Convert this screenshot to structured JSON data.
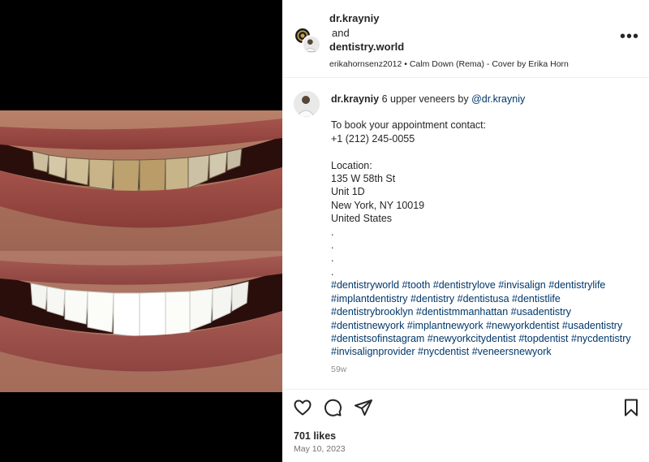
{
  "post": {
    "header": {
      "user1": "dr.krayniy",
      "and_text": "and",
      "user2": "dentistry.world",
      "audio": "erikahornsenz2012 • Calm Down (Rema) - Cover by Erika Horn"
    },
    "caption": {
      "username": "dr.krayniy",
      "intro": "6 upper veneers by",
      "mention": "@dr.krayniy",
      "body": "To book your appointment contact:\n+1 (212) 245-0055\n\nLocation:\n135 W 58th St\nUnit 1D\nNew York, NY 10019\nUnited States\n.\n.\n.\n.",
      "hashtags": "#dentistryworld #tooth #dentistrylove #invisalign #dentistrylife #implantdentistry #dentistry #dentistusa #dentistlife #dentistrybrooklyn #dentistmmanhattan #usadentistry #dentistnewyork #implantnewyork #newyorkdentist #usadentistry #dentistsofinstagram #newyorkcitydentist #topdentist #nycdentistry #invisalignprovider #nycdentist #veneersnewyork",
      "time_ago": "59w"
    },
    "likes": "701 likes",
    "date": "May 10, 2023",
    "icons": {
      "more": "more-options-icon",
      "like": "heart-icon",
      "comment": "comment-bubble-icon",
      "share": "paper-plane-icon",
      "save": "bookmark-icon"
    },
    "colors": {
      "link": "#00376b",
      "text": "#262626",
      "muted": "#8e8e8e",
      "media_bg": "#000000"
    }
  }
}
